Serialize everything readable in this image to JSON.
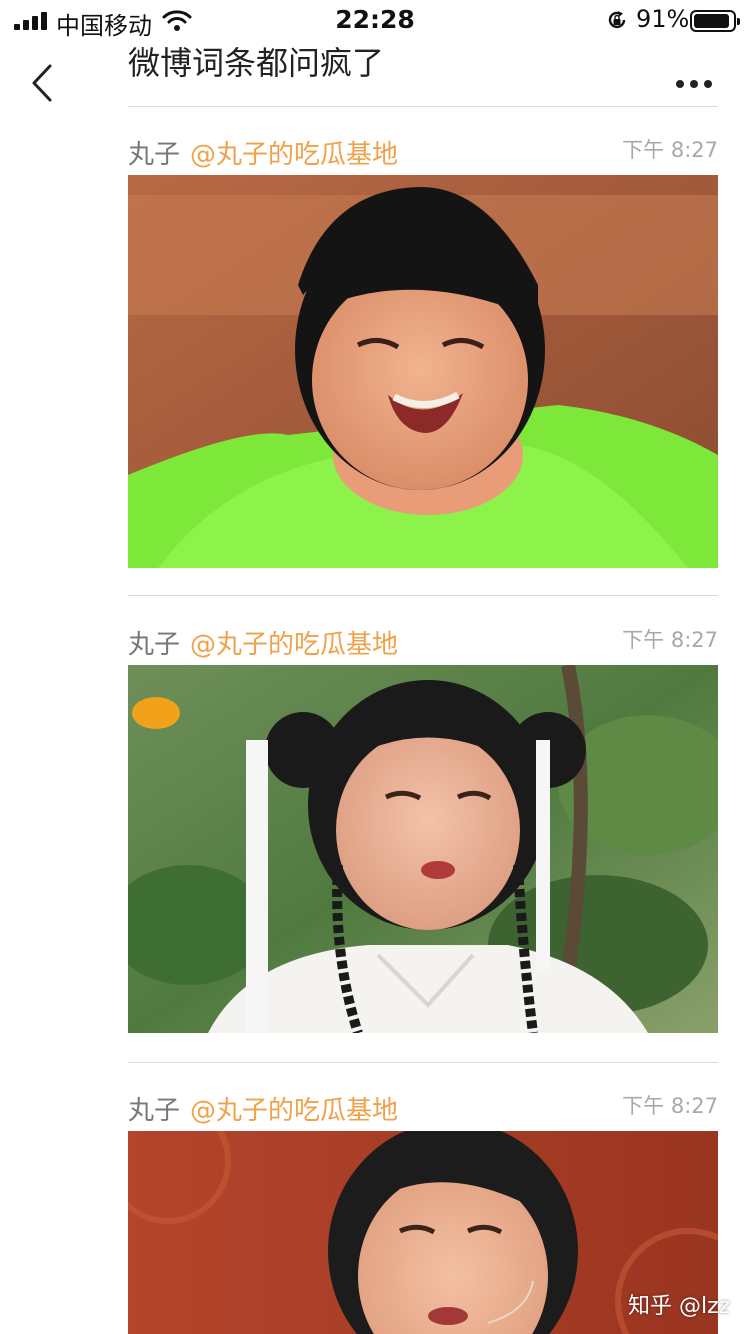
{
  "status_bar": {
    "carrier": "中国移动",
    "time": "22:28",
    "battery_percent": "91%",
    "battery_level": 0.91,
    "icons": [
      "signal-icon",
      "wifi-icon",
      "orientation-lock-icon",
      "battery-icon"
    ]
  },
  "nav": {
    "title": "微博词条都问疯了",
    "back_icon": "chevron-left-icon",
    "more_icon": "more-dots-icon"
  },
  "posts": [
    {
      "author": "丸子",
      "mention": "@丸子的吃瓜基地",
      "time": "下午 8:27"
    },
    {
      "author": "丸子",
      "mention": "@丸子的吃瓜基地",
      "time": "下午 8:27"
    },
    {
      "author": "丸子",
      "mention": "@丸子的吃瓜基地",
      "time": "下午 8:27"
    }
  ],
  "watermark": "知乎 @lzz",
  "colors": {
    "mention": "#f0a24a",
    "time": "#a8a8a8",
    "divider": "#dcdcdc"
  }
}
